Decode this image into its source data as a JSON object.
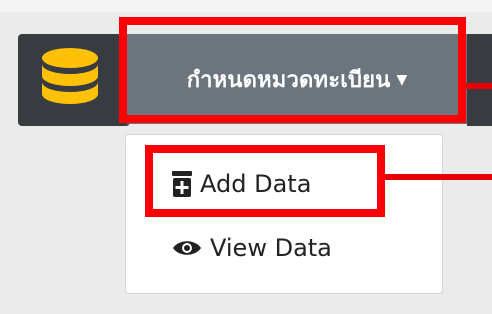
{
  "menu": {
    "label": "กำหนดหมวดทะเบียน",
    "caret": "▼"
  },
  "dropdown": {
    "items": [
      {
        "label": "Add Data",
        "icon": "add-document-icon"
      },
      {
        "label": "View Data",
        "icon": "eye-icon"
      }
    ]
  },
  "colors": {
    "accent": "#ffc107",
    "highlight": "#ff0000",
    "button": "#6c757d",
    "dark": "#383b40"
  }
}
